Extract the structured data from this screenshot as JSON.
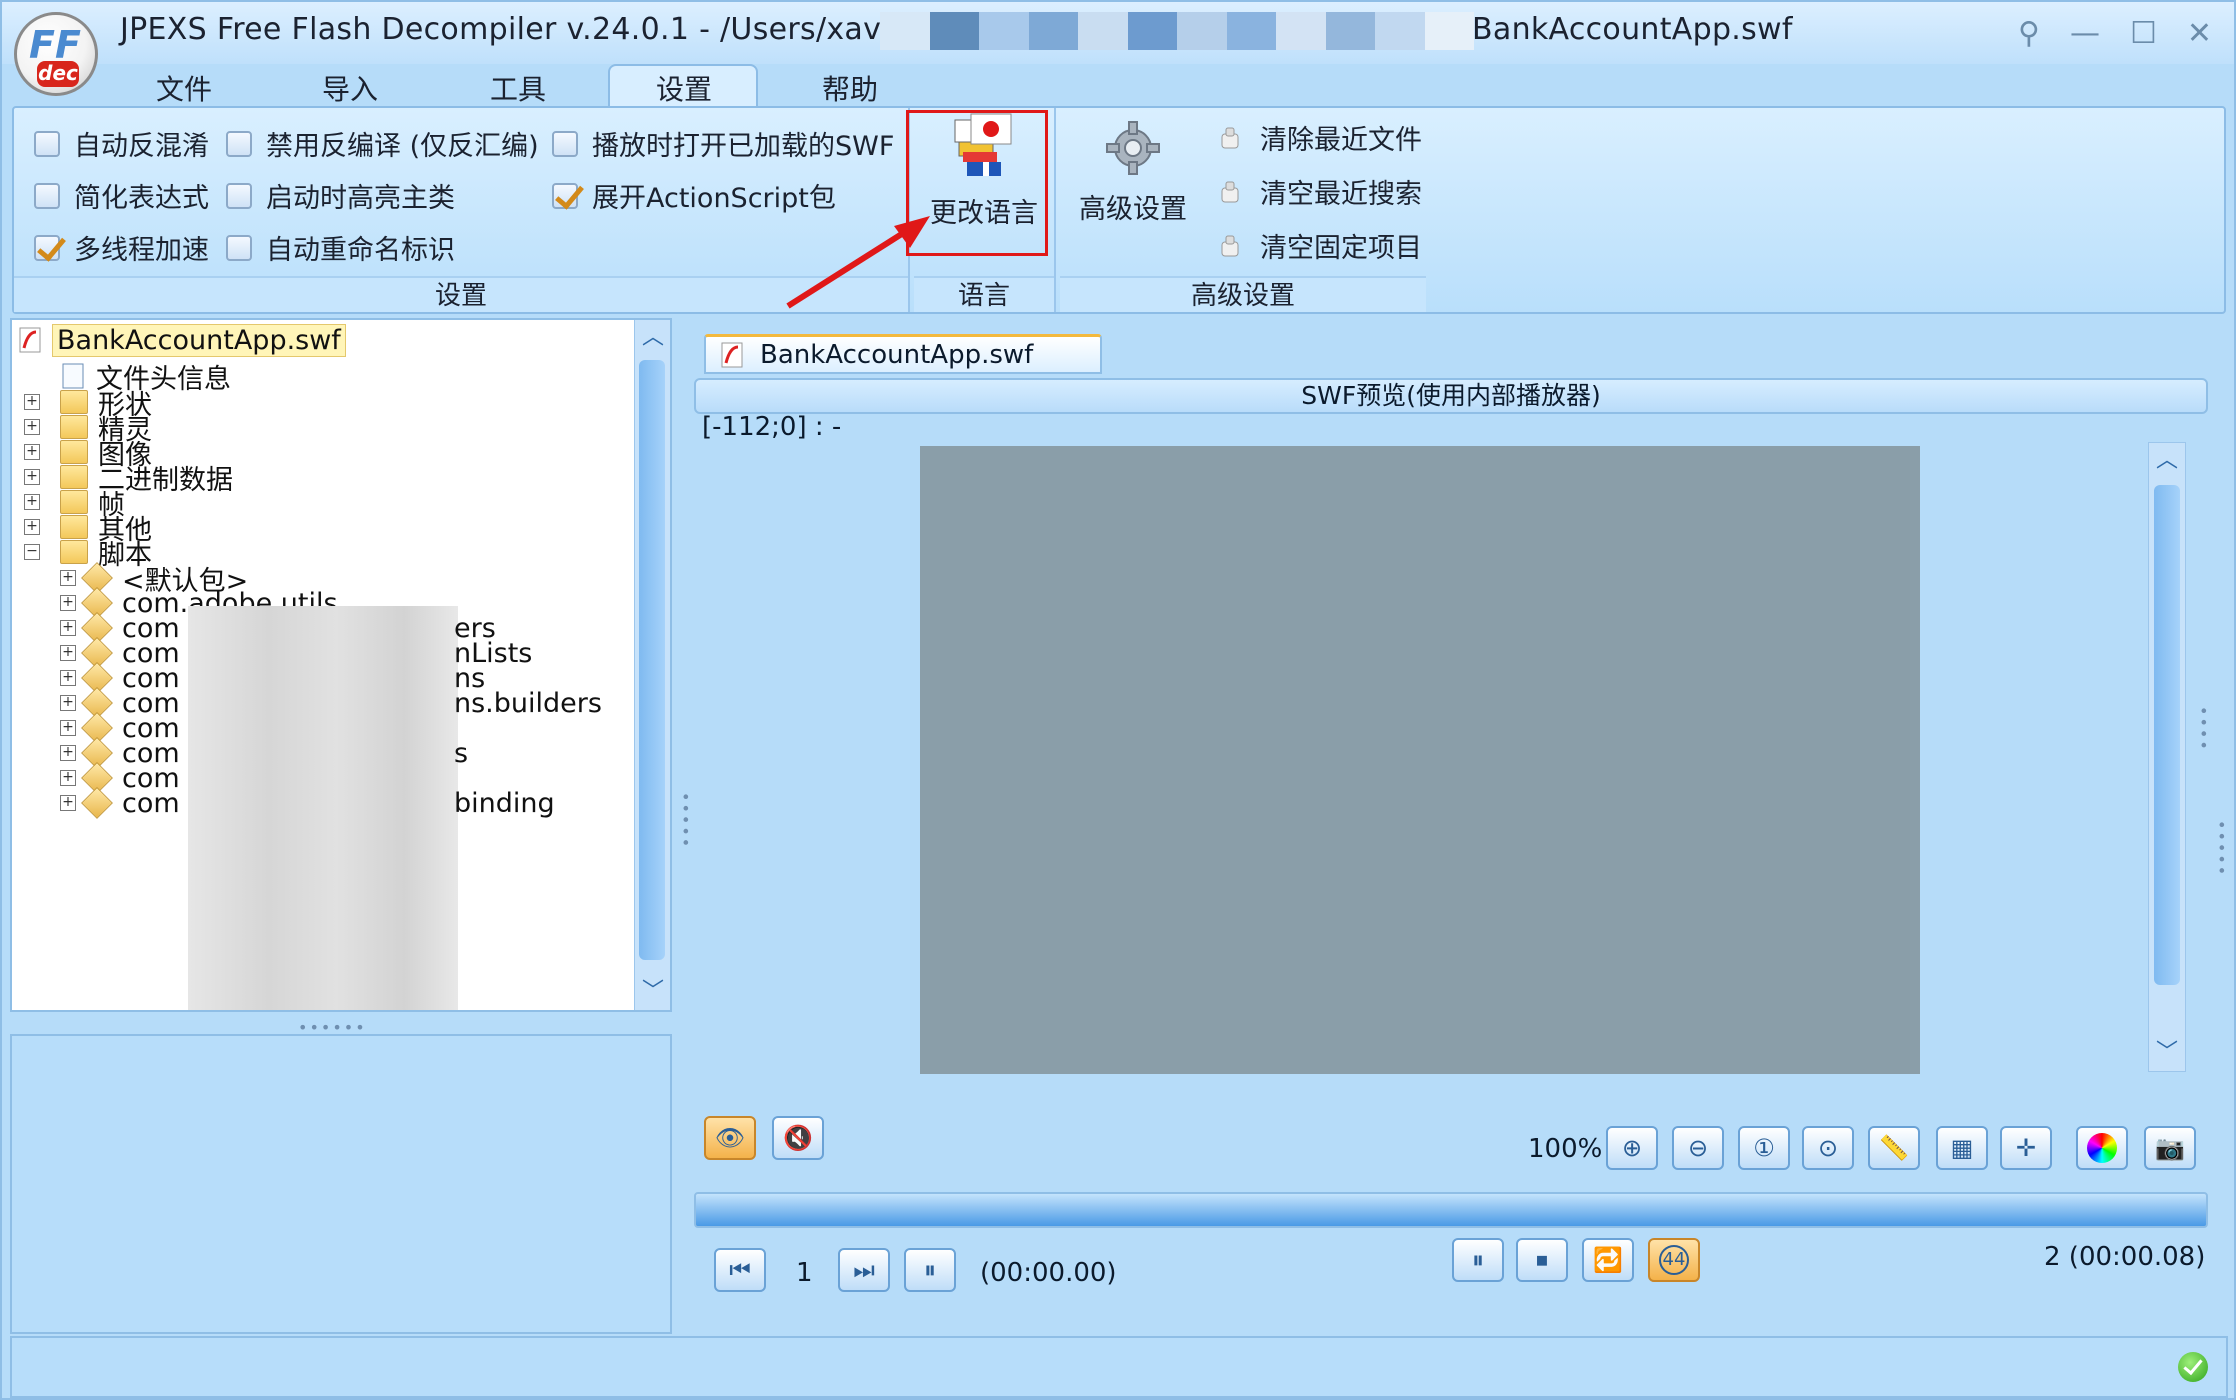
{
  "window": {
    "title_part1": "JPEXS Free Flash Decompiler v.24.0.1 - /Users/xavier/",
    "title_part2": "BankAccountApp.swf",
    "logo_top": "FF",
    "logo_bottom": "dec"
  },
  "menu": {
    "items": [
      "文件",
      "导入",
      "工具",
      "设置",
      "帮助"
    ],
    "active": "设置"
  },
  "ribbon": {
    "settings_group": {
      "label": "设置",
      "checkboxes": [
        {
          "label": "自动反混淆",
          "checked": false
        },
        {
          "label": "禁用反编译 (仅反汇编)",
          "checked": false
        },
        {
          "label": "播放时打开已加载的SWF",
          "checked": false
        },
        {
          "label": "简化表达式",
          "checked": false
        },
        {
          "label": "启动时高亮主类",
          "checked": false
        },
        {
          "label": "展开ActionScript包",
          "checked": true
        },
        {
          "label": "多线程加速",
          "checked": true
        },
        {
          "label": "自动重命名标识",
          "checked": false
        }
      ]
    },
    "language_group": {
      "label": "语言",
      "button": "更改语言"
    },
    "advanced_group": {
      "label": "高级设置",
      "button": "高级设置",
      "actions": [
        "清除最近文件",
        "清空最近搜索",
        "清空固定项目"
      ]
    }
  },
  "tree": {
    "root": "BankAccountApp.swf",
    "nodes": [
      "文件头信息",
      "形状",
      "精灵",
      "图像",
      "二进制数据",
      "帧",
      "其他",
      "脚本"
    ],
    "packages": [
      "<默认包>",
      "com.adobe.utils",
      "com",
      "com",
      "com",
      "com",
      "com",
      "com",
      "com",
      "com"
    ],
    "package_suffixes": [
      "",
      "",
      "ers",
      "nLists",
      "ns",
      "ns.builders",
      "",
      "s",
      "",
      "binding"
    ]
  },
  "preview": {
    "file_tab": "BankAccountApp.swf",
    "header": "SWF预览(使用内部播放器)",
    "coord": "[-112;0] :  -",
    "zoom": "100%",
    "frame_current": "1",
    "time_current": "(00:00.00)",
    "frame_total": "2 (00:00.08)",
    "fps_badge": "44"
  },
  "colors": {
    "accent": "#b6dcf9",
    "highlight": "#e01818",
    "stage": "#8a9ea9"
  }
}
